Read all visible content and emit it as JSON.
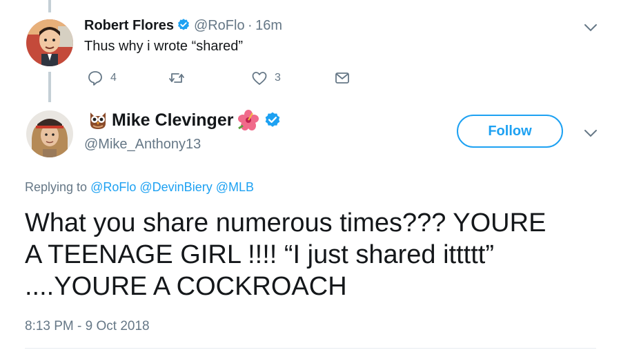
{
  "parent_tweet": {
    "author_name": "Robert Flores",
    "handle": "@RoFlo",
    "separator": "·",
    "time": "16m",
    "text": "Thus why i wrote “shared”",
    "reply_count": "4",
    "retweet_count": "",
    "like_count": "3"
  },
  "main_tweet": {
    "author_name": "Mike Clevinger",
    "name_emoji_before": "owl-emoji",
    "name_emoji_after": "hibiscus-emoji",
    "handle": "@Mike_Anthony13",
    "follow_label": "Follow",
    "replying_prefix": "Replying to",
    "replying_to": [
      "@RoFlo",
      "@DevinBiery",
      "@MLB"
    ],
    "text_lines": [
      "What you share numerous times??? YOURE",
      "A TEENAGE GIRL !!!! “I just shared ittttt”",
      "....YOURE A COCKROACH"
    ],
    "timestamp": "8:13 PM - 9 Oct 2018"
  },
  "colors": {
    "accent": "#1da1f2",
    "secondary_text": "#657786",
    "primary_text": "#14171a",
    "thread_line": "#c4cfd6"
  },
  "icons": [
    "reply-icon",
    "retweet-icon",
    "like-icon",
    "dm-icon",
    "verified-icon",
    "chevron-down-icon"
  ]
}
